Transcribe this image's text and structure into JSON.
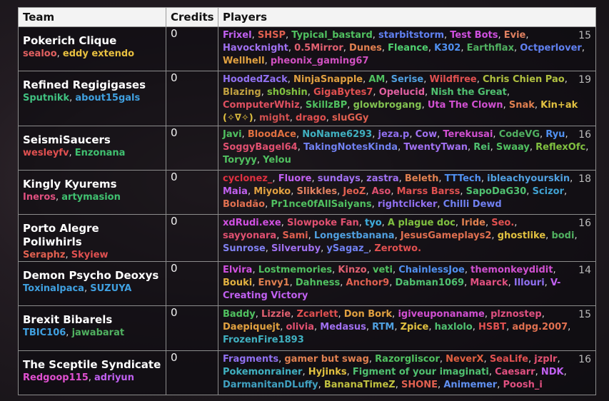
{
  "headers": {
    "team": "Team",
    "credits": "Credits",
    "players": "Players"
  },
  "teams": [
    {
      "name": "Pokerich Clique",
      "captains": [
        {
          "name": "sealoo",
          "color": "#e06060"
        },
        {
          "name": "eddy extendo",
          "color": "#e8c040"
        }
      ],
      "credits": "0",
      "count": "15",
      "players": [
        {
          "name": "Frixel",
          "color": "#c060f0"
        },
        {
          "name": "SHSP",
          "color": "#e06050"
        },
        {
          "name": "Typical_bastard",
          "color": "#50c060"
        },
        {
          "name": "starbitstorm",
          "color": "#6080f0"
        },
        {
          "name": "Test Bots",
          "color": "#d050e0"
        },
        {
          "name": "Evie",
          "color": "#e08060"
        },
        {
          "name": "Havocknight",
          "color": "#a070f0"
        },
        {
          "name": "0.5Mirror",
          "color": "#e06070"
        },
        {
          "name": "Dunes",
          "color": "#e08050"
        },
        {
          "name": "Fleance",
          "color": "#50d070"
        },
        {
          "name": "K302",
          "color": "#5090f0"
        },
        {
          "name": "Earthflax",
          "color": "#50b060"
        },
        {
          "name": "Octperlover",
          "color": "#6080f0"
        },
        {
          "name": "Wellhell",
          "color": "#e0a040"
        },
        {
          "name": "pheonix_gaming67",
          "color": "#d050c0"
        }
      ]
    },
    {
      "name": "Refined Regigigases",
      "captains": [
        {
          "name": "Sputnikk",
          "color": "#40c080"
        },
        {
          "name": "about15gals",
          "color": "#40a0e0"
        }
      ],
      "credits": "0",
      "count": "19",
      "players": [
        {
          "name": "HoodedZack",
          "color": "#9070f0"
        },
        {
          "name": "NinjaSnapple",
          "color": "#e0a040"
        },
        {
          "name": "AM",
          "color": "#50c060"
        },
        {
          "name": "Serise",
          "color": "#50a0e0"
        },
        {
          "name": "Wildfiree",
          "color": "#e05050"
        },
        {
          "name": "Chris Chien Pao",
          "color": "#b0c040"
        },
        {
          "name": "Blazing",
          "color": "#c0a040"
        },
        {
          "name": "sh0shin",
          "color": "#80c040"
        },
        {
          "name": "GigaBytes7",
          "color": "#e05050"
        },
        {
          "name": "Opelucid",
          "color": "#e060a0"
        },
        {
          "name": "Nish the Great",
          "color": "#50c070"
        },
        {
          "name": "ComputerWhiz",
          "color": "#e05060"
        },
        {
          "name": "SkillzBP",
          "color": "#50c060"
        },
        {
          "name": "glowbrogang",
          "color": "#80c050"
        },
        {
          "name": "Uta The Clown",
          "color": "#d050d0"
        },
        {
          "name": "Snak",
          "color": "#e08050"
        },
        {
          "name": "Kin+ak (✧∇✧)",
          "color": "#e0c040"
        },
        {
          "name": "might",
          "color": "#d05050"
        },
        {
          "name": "drago",
          "color": "#e05050"
        },
        {
          "name": "sluGGy",
          "color": "#e06050"
        }
      ]
    },
    {
      "name": "SeismiSaucers",
      "captains": [
        {
          "name": "wesleyfv",
          "color": "#e05050"
        },
        {
          "name": "Enzonana",
          "color": "#40c070"
        }
      ],
      "credits": "0",
      "count": "16",
      "players": [
        {
          "name": "Javi",
          "color": "#50c060"
        },
        {
          "name": "BloodAce",
          "color": "#e07040"
        },
        {
          "name": "NoName6293",
          "color": "#40b0c0"
        },
        {
          "name": "jeza.p",
          "color": "#9070f0"
        },
        {
          "name": "Cow",
          "color": "#a070f0"
        },
        {
          "name": "Terekusai",
          "color": "#d050d0"
        },
        {
          "name": "CodeVG",
          "color": "#50b060"
        },
        {
          "name": "Ryu",
          "color": "#5090f0"
        },
        {
          "name": "SoggyBagel64",
          "color": "#e05070"
        },
        {
          "name": "TakingNotesKinda",
          "color": "#7080f0"
        },
        {
          "name": "TwentyTwan",
          "color": "#a070f0"
        },
        {
          "name": "Rei",
          "color": "#50c070"
        },
        {
          "name": "Swaay",
          "color": "#50c060"
        },
        {
          "name": "ReflexOfc",
          "color": "#80c040"
        },
        {
          "name": "Toryyy",
          "color": "#50c060"
        },
        {
          "name": "Yelou",
          "color": "#50c060"
        }
      ]
    },
    {
      "name": "Kingly Kyurems",
      "captains": [
        {
          "name": "Ineros",
          "color": "#e05080"
        },
        {
          "name": "artymasion",
          "color": "#40c070"
        }
      ],
      "credits": "0",
      "count": "18",
      "players": [
        {
          "name": "cyclonez_",
          "color": "#e03040"
        },
        {
          "name": "Fluore",
          "color": "#c060f0"
        },
        {
          "name": "sundays",
          "color": "#a070f0"
        },
        {
          "name": "zastra",
          "color": "#a070f0"
        },
        {
          "name": "Beleth",
          "color": "#e08050"
        },
        {
          "name": "TTTech",
          "color": "#5090f0"
        },
        {
          "name": "ibleachyourskin",
          "color": "#50a0e0"
        },
        {
          "name": "Maia",
          "color": "#c060f0"
        },
        {
          "name": "Miyoko",
          "color": "#e0a040"
        },
        {
          "name": "Slikkles",
          "color": "#e08060"
        },
        {
          "name": "JeoZ",
          "color": "#e06050"
        },
        {
          "name": "Aso",
          "color": "#e05070"
        },
        {
          "name": "Marss Barss",
          "color": "#e05050"
        },
        {
          "name": "SapoDaG30",
          "color": "#50c070"
        },
        {
          "name": "Scizor",
          "color": "#40a0d0"
        },
        {
          "name": "Boladão",
          "color": "#e07050"
        },
        {
          "name": "Pr1nce0fAllSaiyans",
          "color": "#50c060"
        },
        {
          "name": "rightclicker",
          "color": "#9070f0"
        },
        {
          "name": "Chilli Dewd",
          "color": "#7080f0"
        }
      ]
    },
    {
      "name": "Porto Alegre Poliwhirls",
      "captains": [
        {
          "name": "Seraphz",
          "color": "#e06050"
        },
        {
          "name": "Skyiew",
          "color": "#e05050"
        }
      ],
      "credits": "0",
      "count": "16",
      "players": [
        {
          "name": "xdRudi.exe",
          "color": "#d050e0"
        },
        {
          "name": "Slowpoke Fan",
          "color": "#e05070"
        },
        {
          "name": "tyo",
          "color": "#40b0e0"
        },
        {
          "name": "A plague doc",
          "color": "#80c040"
        },
        {
          "name": "Iride",
          "color": "#e08050"
        },
        {
          "name": "Seo.",
          "color": "#e05050"
        },
        {
          "name": "sayyonara",
          "color": "#e05070"
        },
        {
          "name": "Sami",
          "color": "#e06050"
        },
        {
          "name": "Longestbanana",
          "color": "#50a0e0"
        },
        {
          "name": "JesusGameplays2",
          "color": "#e07050"
        },
        {
          "name": "ghostlike",
          "color": "#e0c040"
        },
        {
          "name": "bodi",
          "color": "#50b060"
        },
        {
          "name": "Sunrose",
          "color": "#8080f0"
        },
        {
          "name": "Silveruby",
          "color": "#a070f0"
        },
        {
          "name": "ySagaz_",
          "color": "#7080f0"
        },
        {
          "name": "Zerotwo.",
          "color": "#e05050"
        }
      ]
    },
    {
      "name": "Demon Psycho Deoxys",
      "captains": [
        {
          "name": "Toxinalpaca",
          "color": "#40a0e0"
        },
        {
          "name": "SUZUYA",
          "color": "#40a0e0"
        }
      ],
      "credits": "0",
      "count": "14",
      "players": [
        {
          "name": "Elvira",
          "color": "#d050e0"
        },
        {
          "name": "Lostmemories",
          "color": "#50c060"
        },
        {
          "name": "Kinzo",
          "color": "#e06070"
        },
        {
          "name": "veti",
          "color": "#50c060"
        },
        {
          "name": "ChainlessJoe",
          "color": "#5090f0"
        },
        {
          "name": "themonkeydidit",
          "color": "#d050d0"
        },
        {
          "name": "Bouki",
          "color": "#e0b040"
        },
        {
          "name": "Envy1",
          "color": "#e08050"
        },
        {
          "name": "Dahness",
          "color": "#50c060"
        },
        {
          "name": "Anchor9",
          "color": "#e06050"
        },
        {
          "name": "Dabman1069",
          "color": "#50c070"
        },
        {
          "name": "Maarck",
          "color": "#e05080"
        },
        {
          "name": "Illouri",
          "color": "#9070f0"
        },
        {
          "name": "V-Creating Victory",
          "color": "#c060f0"
        }
      ]
    },
    {
      "name": "Brexit Bibarels",
      "captains": [
        {
          "name": "TBIC106",
          "color": "#40a0e0"
        },
        {
          "name": "jawabarat",
          "color": "#50b060"
        }
      ],
      "credits": "0",
      "count": "15",
      "players": [
        {
          "name": "Baddy",
          "color": "#50c060"
        },
        {
          "name": "Lizzie",
          "color": "#e06070"
        },
        {
          "name": "Zcarlett",
          "color": "#e05050"
        },
        {
          "name": "Don Bork",
          "color": "#e0a040"
        },
        {
          "name": "igiveuponaname",
          "color": "#d050d0"
        },
        {
          "name": "plznostep",
          "color": "#e05080"
        },
        {
          "name": "Daepiquejt",
          "color": "#e0a040"
        },
        {
          "name": "olivia",
          "color": "#e05070"
        },
        {
          "name": "Medasus",
          "color": "#a070f0"
        },
        {
          "name": "RTM",
          "color": "#50a0e0"
        },
        {
          "name": "Zpice",
          "color": "#e0c040"
        },
        {
          "name": "haxlolo",
          "color": "#50c070"
        },
        {
          "name": "HSBT",
          "color": "#e05050"
        },
        {
          "name": "adpg.2007",
          "color": "#e07050"
        },
        {
          "name": "FrozenFire1893",
          "color": "#40b0c0"
        }
      ]
    },
    {
      "name": "The Sceptile Syndicate",
      "captains": [
        {
          "name": "Redgoop115",
          "color": "#e050d0"
        },
        {
          "name": "adriyun",
          "color": "#c060f0"
        }
      ],
      "credits": "0",
      "count": "16",
      "players": [
        {
          "name": "Fragments",
          "color": "#9070f0"
        },
        {
          "name": "gamer but swag",
          "color": "#e08050"
        },
        {
          "name": "Razorgliscor",
          "color": "#50c060"
        },
        {
          "name": "NeverX",
          "color": "#e06040"
        },
        {
          "name": "SeaLife",
          "color": "#e05050"
        },
        {
          "name": "jzplr",
          "color": "#e05070"
        },
        {
          "name": "Pokemonrainer",
          "color": "#40b0c0"
        },
        {
          "name": "Hyjinks",
          "color": "#e0c040"
        },
        {
          "name": "Figment of your imaginati",
          "color": "#50c070"
        },
        {
          "name": "Caesarr",
          "color": "#e05080"
        },
        {
          "name": "NDK",
          "color": "#c060f0"
        },
        {
          "name": "DarmanitanDLuffy",
          "color": "#40a0c0"
        },
        {
          "name": "BananaTimeZ",
          "color": "#c0c040"
        },
        {
          "name": "SHONE",
          "color": "#e06050"
        },
        {
          "name": "Animemer",
          "color": "#6090f0"
        },
        {
          "name": "Poosh_i",
          "color": "#e05080"
        }
      ]
    }
  ]
}
